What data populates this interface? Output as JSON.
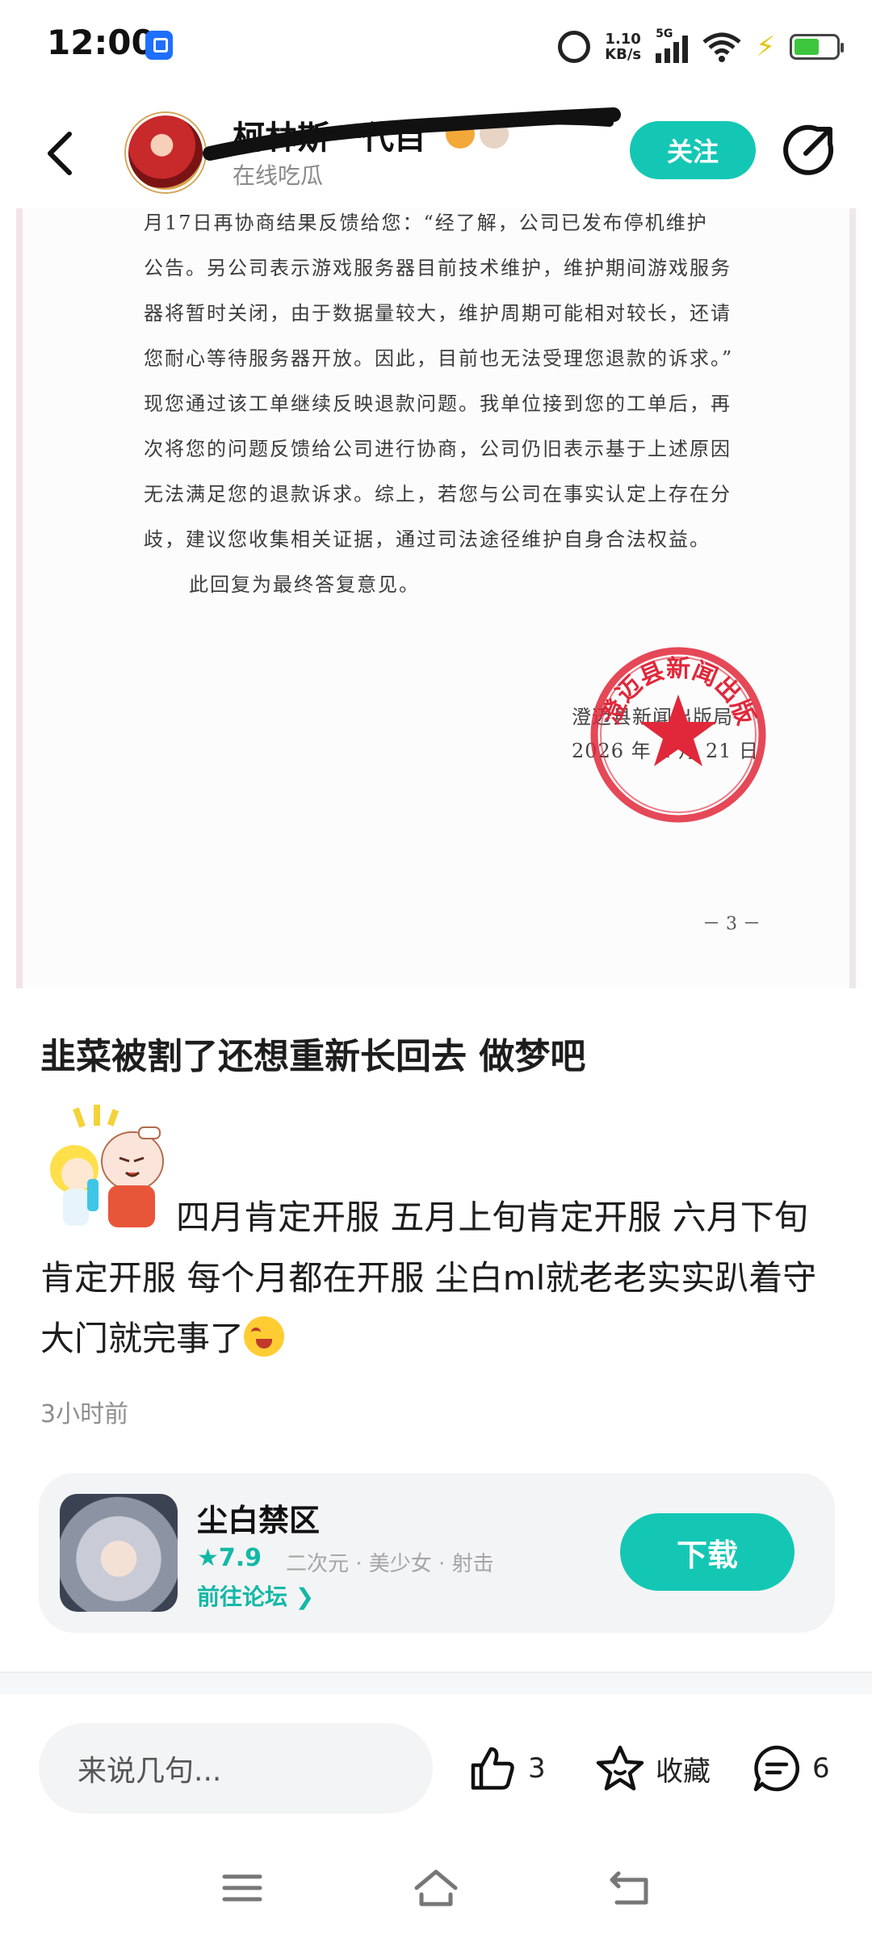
{
  "status_bar": {
    "time": "12:00",
    "net_speed_value": "1.10",
    "net_speed_unit": "KB/s",
    "network": "5G",
    "battery_level": 0.6
  },
  "header": {
    "username": "柯林斯一代目",
    "subtitle": "在线吃瓜",
    "follow_label": "关注"
  },
  "document": {
    "lines": [
      "月17日再协商结果反馈给您：“经了解，公司已发布停机维护",
      "公告。另公司表示游戏服务器目前技术维护，维护期间游戏服务",
      "器将暂时关闭，由于数据量较大，维护周期可能相对较长，还请",
      "您耐心等待服务器开放。因此，目前也无法受理您退款的诉求。”",
      "现您通过该工单继续反映退款问题。我单位接到您的工单后，再",
      "次将您的问题反馈给公司进行协商，公司仍旧表示基于上述原因",
      "无法满足您的退款诉求。综上，若您与公司在事实认定上存在分",
      "歧，建议您收集相关证据，通过司法途径维护自身合法权益。"
    ],
    "closing": "此回复为最终答复意见。",
    "organization": "澄迈县新闻出版局",
    "date": "2026 年 4 月 21 日",
    "page_number": "－ 3 －"
  },
  "post": {
    "title": "韭菜被割了还想重新长回去 做梦吧",
    "body": "四月肯定开服 五月上旬肯定开服 六月下旬肯定开服  每个月都在开服 尘白ml就老老实实趴着守大门就完事了",
    "time_ago": "3小时前"
  },
  "game_card": {
    "name": "尘白禁区",
    "rating": "★7.9",
    "tags": "二次元 · 美少女 · 射击",
    "forum_link": "前往论坛 ❯",
    "download_label": "下载"
  },
  "action_bar": {
    "comment_placeholder": "来说几句...",
    "like_count": "3",
    "favorite_label": "收藏",
    "comment_count": "6"
  },
  "colors": {
    "accent": "#14c7b4",
    "seal_red": "#e0283a"
  },
  "icons": [
    "back-arrow-icon",
    "share-icon",
    "thumbs-up-icon",
    "star-icon",
    "comment-bubble-icon",
    "menu-icon",
    "home-icon",
    "back-icon"
  ]
}
